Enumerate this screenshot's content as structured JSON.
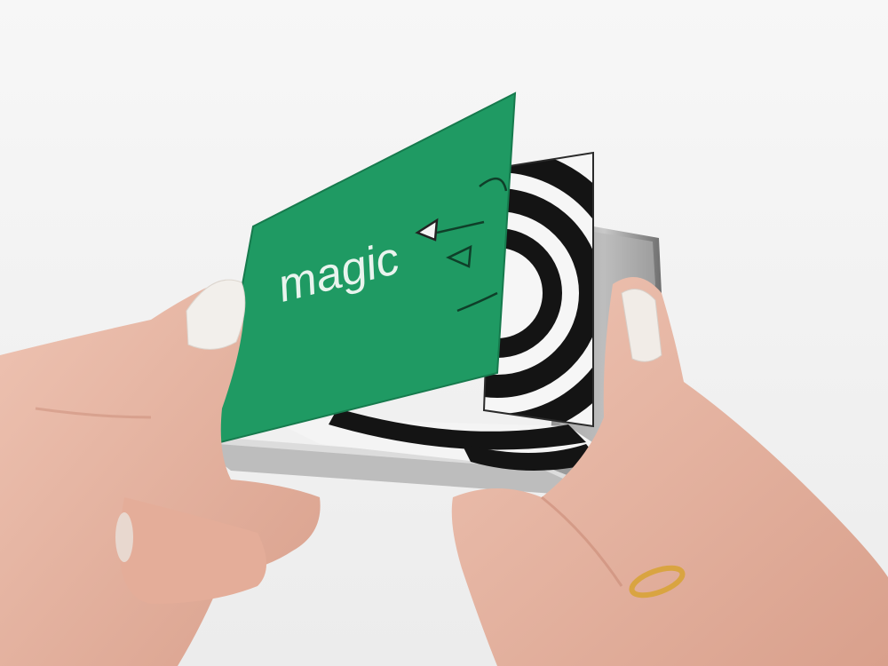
{
  "photo": {
    "cover_text": "magic"
  },
  "colors": {
    "background": "#f3f3f3",
    "cover_green": "#1f9a63",
    "cover_text": "#e9f4ee",
    "skin": "#e9b9a6",
    "skin_shadow": "#d49c88",
    "nail": "#f2efeb",
    "ring": "#d9a441",
    "page_black": "#141414",
    "page_white": "#f6f6f6"
  },
  "icons": [
    "watering-can-icon"
  ]
}
